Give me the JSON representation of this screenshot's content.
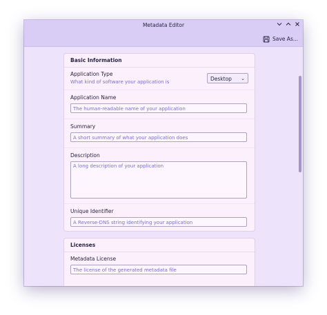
{
  "window": {
    "title": "Metadata Editor"
  },
  "toolbar": {
    "save_label": "Save As..."
  },
  "basic": {
    "title": "Basic Information",
    "app_type": {
      "label": "Application Type",
      "help": "What kind of software your application is",
      "value": "Desktop"
    },
    "app_name": {
      "label": "Application Name",
      "placeholder": "The human-readable name of your application"
    },
    "summary": {
      "label": "Summary",
      "placeholder": "A short summary of what your application does"
    },
    "description": {
      "label": "Description",
      "placeholder": "A long description of your application"
    },
    "unique_id": {
      "label": "Unique Identifier",
      "placeholder": "A Reverse-DNS string identifying your application"
    }
  },
  "licenses": {
    "title": "Licenses",
    "metadata_license": {
      "label": "Metadata License",
      "placeholder": "The license of the generated metadata file"
    }
  }
}
